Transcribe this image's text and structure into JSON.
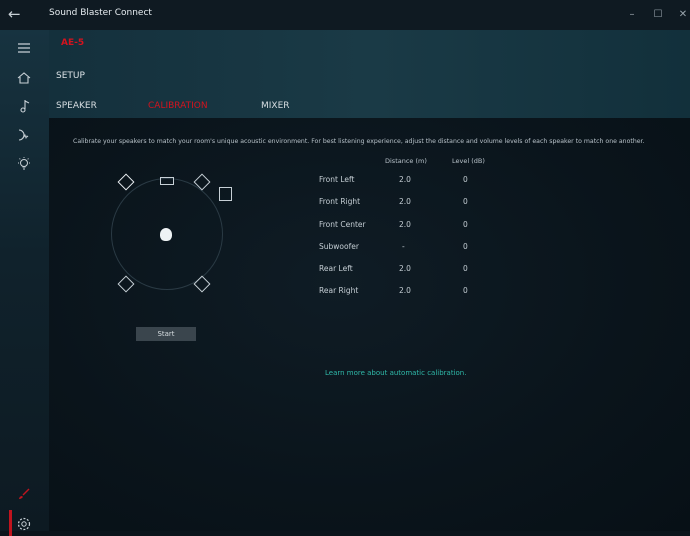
{
  "app": {
    "title": "Sound Blaster Connect",
    "model": "AE-5"
  },
  "header": {
    "section": "SETUP",
    "tabs": [
      {
        "label": "SPEAKER",
        "active": false
      },
      {
        "label": "CALIBRATION",
        "active": true
      },
      {
        "label": "MIXER",
        "active": false
      }
    ]
  },
  "calibration": {
    "description": "Calibrate your speakers to match your room's unique acoustic environment. For best listening experience, adjust the distance and volume levels of each speaker to match one another.",
    "columns": {
      "distance": "Distance (m)",
      "level": "Level (dB)"
    },
    "rows": [
      {
        "name": "Front Left",
        "distance": "2.0",
        "level": "0"
      },
      {
        "name": "Front Right",
        "distance": "2.0",
        "level": "0"
      },
      {
        "name": "Front Center",
        "distance": "2.0",
        "level": "0"
      },
      {
        "name": "Subwoofer",
        "distance": "-",
        "level": "0"
      },
      {
        "name": "Rear Left",
        "distance": "2.0",
        "level": "0"
      },
      {
        "name": "Rear Right",
        "distance": "2.0",
        "level": "0"
      }
    ],
    "start_label": "Start",
    "learn_more": "Learn more about automatic calibration."
  },
  "colors": {
    "accent": "#d3131e",
    "link": "#2fb8a8"
  },
  "icons": [
    "back-arrow-icon",
    "hamburger-icon",
    "home-icon",
    "music-note-icon",
    "headphone-wave-icon",
    "lightbulb-icon",
    "paint-brush-icon",
    "settings-gear-icon"
  ]
}
